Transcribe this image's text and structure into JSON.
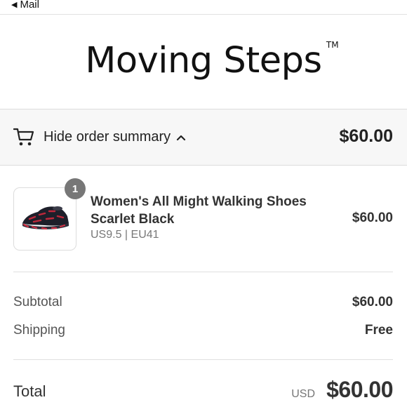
{
  "status_bar": {
    "back_label": "Mail"
  },
  "brand": {
    "name": "Moving Steps",
    "tm": "TM"
  },
  "summary": {
    "toggle_label": "Hide order summary",
    "total": "$60.00"
  },
  "product": {
    "quantity": "1",
    "name": "Women's All Might Walking Shoes Scarlet Black",
    "variant": "US9.5 | EU41",
    "price": "$60.00"
  },
  "costs": {
    "subtotal_label": "Subtotal",
    "subtotal_value": "$60.00",
    "shipping_label": "Shipping",
    "shipping_value": "Free"
  },
  "total": {
    "label": "Total",
    "currency": "USD",
    "value": "$60.00"
  },
  "icons": [
    "back-triangle-icon",
    "cart-icon",
    "chevron-up-icon",
    "shoe-thumbnail"
  ]
}
